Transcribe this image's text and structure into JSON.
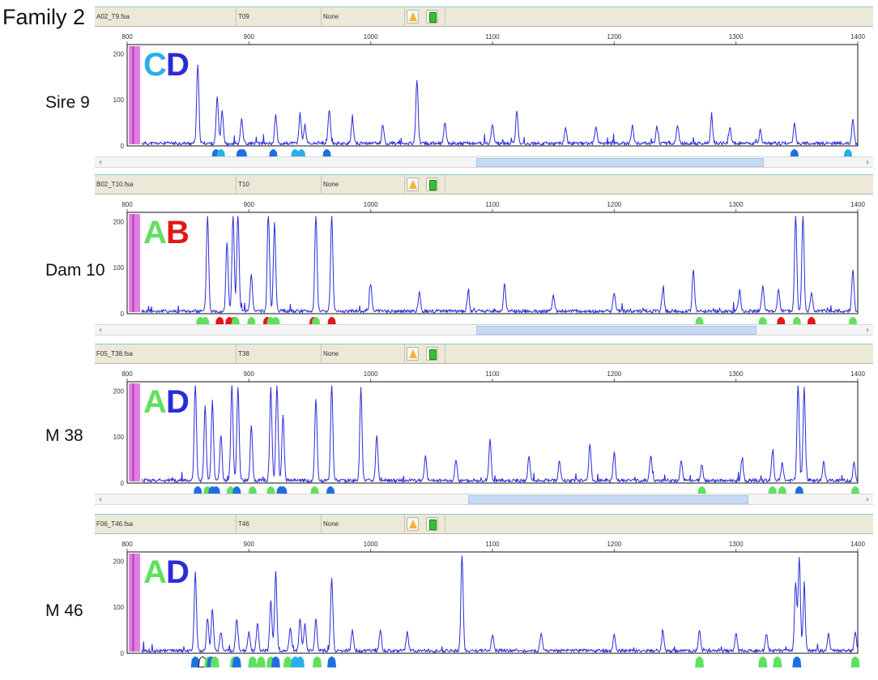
{
  "family_title": "Family 2",
  "colors": {
    "trace": "#2b2bd9",
    "pink": "#e07fe0",
    "peak_blue": "#1f6fe0",
    "peak_light_blue": "#2ab0e8",
    "peak_green": "#5fe05f",
    "peak_red": "#e01818",
    "axis": "#111111"
  },
  "panels": [
    {
      "sample_label": "Sire 9",
      "file": "A02_T9.fsa",
      "sample": "T09",
      "status": "None",
      "alleles": [
        {
          "letter": "C",
          "color": "#2ab0e8"
        },
        {
          "letter": "D",
          "color": "#2b2bd9"
        }
      ],
      "has_scrollbar": true,
      "scroll_thumb": [
        0.49,
        0.86
      ],
      "peaks": [
        [
          858,
          170
        ],
        [
          874,
          100
        ],
        [
          878,
          70
        ],
        [
          894,
          55
        ],
        [
          922,
          60
        ],
        [
          942,
          65
        ],
        [
          946,
          40
        ],
        [
          966,
          75
        ],
        [
          1038,
          140
        ],
        [
          1120,
          70
        ],
        [
          1280,
          55
        ],
        [
          1348,
          45
        ],
        [
          1396,
          50
        ]
      ],
      "noise": [
        [
          985,
          50
        ],
        [
          1010,
          40
        ],
        [
          1061,
          45
        ],
        [
          1100,
          40
        ],
        [
          1160,
          35
        ],
        [
          1185,
          35
        ],
        [
          1215,
          38
        ],
        [
          1235,
          35
        ],
        [
          1252,
          40
        ],
        [
          1295,
          35
        ],
        [
          1320,
          30
        ]
      ],
      "markers": [
        {
          "bp": 873,
          "c": "blue"
        },
        {
          "bp": 877,
          "c": "light_blue"
        },
        {
          "bp": 893,
          "c": "blue"
        },
        {
          "bp": 895,
          "c": "blue"
        },
        {
          "bp": 920,
          "c": "blue"
        },
        {
          "bp": 938,
          "c": "light_blue"
        },
        {
          "bp": 943,
          "c": "light_blue"
        },
        {
          "bp": 964,
          "c": "blue"
        },
        {
          "bp": 1348,
          "c": "blue"
        },
        {
          "bp": 1392,
          "c": "light_blue"
        }
      ]
    },
    {
      "sample_label": "Dam 10",
      "file": "B02_T10.fsa",
      "sample": "T10",
      "status": "None",
      "alleles": [
        {
          "letter": "A",
          "color": "#5fe05f"
        },
        {
          "letter": "B",
          "color": "#e01818"
        }
      ],
      "has_scrollbar": true,
      "scroll_thumb": [
        0.49,
        0.85
      ],
      "peaks": [
        [
          866,
          210
        ],
        [
          882,
          150
        ],
        [
          887,
          210
        ],
        [
          891,
          210
        ],
        [
          902,
          80
        ],
        [
          916,
          210
        ],
        [
          921,
          190
        ],
        [
          955,
          210
        ],
        [
          968,
          210
        ],
        [
          1110,
          60
        ],
        [
          1265,
          90
        ],
        [
          1322,
          55
        ],
        [
          1335,
          50
        ],
        [
          1349,
          210
        ],
        [
          1355,
          210
        ],
        [
          1396,
          90
        ]
      ],
      "noise": [
        [
          1000,
          60
        ],
        [
          1040,
          40
        ],
        [
          1080,
          40
        ],
        [
          1150,
          35
        ],
        [
          1200,
          40
        ],
        [
          1240,
          45
        ],
        [
          1303,
          45
        ],
        [
          1362,
          40
        ]
      ],
      "markers": [
        {
          "bp": 860,
          "c": "green"
        },
        {
          "bp": 864,
          "c": "green"
        },
        {
          "bp": 876,
          "c": "red"
        },
        {
          "bp": 884,
          "c": "red"
        },
        {
          "bp": 888,
          "c": "red"
        },
        {
          "bp": 889,
          "c": "green"
        },
        {
          "bp": 902,
          "c": "green"
        },
        {
          "bp": 915,
          "c": "red"
        },
        {
          "bp": 918,
          "c": "green"
        },
        {
          "bp": 922,
          "c": "green"
        },
        {
          "bp": 953,
          "c": "red"
        },
        {
          "bp": 955,
          "c": "green"
        },
        {
          "bp": 968,
          "c": "red"
        },
        {
          "bp": 1270,
          "c": "green"
        },
        {
          "bp": 1322,
          "c": "green"
        },
        {
          "bp": 1337,
          "c": "red"
        },
        {
          "bp": 1350,
          "c": "green"
        },
        {
          "bp": 1362,
          "c": "red"
        },
        {
          "bp": 1396,
          "c": "green"
        }
      ]
    },
    {
      "sample_label": "M 38",
      "file": "F05_T38.fsa",
      "sample": "T38",
      "status": "None",
      "alleles": [
        {
          "letter": "A",
          "color": "#5fe05f"
        },
        {
          "letter": "D",
          "color": "#2b2bd9"
        }
      ],
      "has_scrollbar": true,
      "scroll_thumb": [
        0.48,
        0.84
      ],
      "peaks": [
        [
          856,
          210
        ],
        [
          864,
          160
        ],
        [
          870,
          170
        ],
        [
          877,
          100
        ],
        [
          886,
          210
        ],
        [
          891,
          200
        ],
        [
          902,
          120
        ],
        [
          918,
          200
        ],
        [
          923,
          210
        ],
        [
          928,
          140
        ],
        [
          955,
          180
        ],
        [
          968,
          210
        ],
        [
          992,
          200
        ],
        [
          1005,
          100
        ],
        [
          1098,
          90
        ],
        [
          1180,
          80
        ],
        [
          1272,
          35
        ],
        [
          1330,
          65
        ],
        [
          1338,
          40
        ],
        [
          1351,
          210
        ],
        [
          1356,
          200
        ],
        [
          1397,
          40
        ]
      ],
      "noise": [
        [
          1045,
          55
        ],
        [
          1070,
          45
        ],
        [
          1130,
          50
        ],
        [
          1155,
          45
        ],
        [
          1200,
          60
        ],
        [
          1230,
          55
        ],
        [
          1255,
          45
        ],
        [
          1305,
          45
        ],
        [
          1372,
          40
        ]
      ],
      "markers": [
        {
          "bp": 858,
          "c": "blue"
        },
        {
          "bp": 866,
          "c": "green"
        },
        {
          "bp": 870,
          "c": "blue"
        },
        {
          "bp": 873,
          "c": "blue"
        },
        {
          "bp": 885,
          "c": "green"
        },
        {
          "bp": 890,
          "c": "blue"
        },
        {
          "bp": 903,
          "c": "green"
        },
        {
          "bp": 918,
          "c": "green"
        },
        {
          "bp": 926,
          "c": "blue"
        },
        {
          "bp": 928,
          "c": "blue"
        },
        {
          "bp": 954,
          "c": "green"
        },
        {
          "bp": 967,
          "c": "blue"
        },
        {
          "bp": 1272,
          "c": "green"
        },
        {
          "bp": 1330,
          "c": "green"
        },
        {
          "bp": 1338,
          "c": "green"
        },
        {
          "bp": 1352,
          "c": "blue"
        },
        {
          "bp": 1398,
          "c": "green"
        }
      ]
    },
    {
      "sample_label": "M 46",
      "file": "F06_T46.fsa",
      "sample": "T46",
      "status": "None",
      "alleles": [
        {
          "letter": "A",
          "color": "#5fe05f"
        },
        {
          "letter": "D",
          "color": "#2b2bd9"
        }
      ],
      "has_scrollbar": false,
      "scroll_thumb": [
        0,
        0
      ],
      "peaks": [
        [
          856,
          170
        ],
        [
          866,
          70
        ],
        [
          870,
          90
        ],
        [
          877,
          40
        ],
        [
          890,
          70
        ],
        [
          900,
          40
        ],
        [
          907,
          60
        ],
        [
          918,
          110
        ],
        [
          922,
          170
        ],
        [
          934,
          50
        ],
        [
          942,
          70
        ],
        [
          946,
          60
        ],
        [
          955,
          70
        ],
        [
          968,
          160
        ],
        [
          1008,
          45
        ],
        [
          1075,
          210
        ],
        [
          1270,
          45
        ],
        [
          1349,
          150
        ],
        [
          1352,
          200
        ],
        [
          1356,
          130
        ]
      ],
      "noise": [
        [
          985,
          45
        ],
        [
          1030,
          40
        ],
        [
          1100,
          35
        ],
        [
          1140,
          40
        ],
        [
          1200,
          35
        ],
        [
          1240,
          40
        ],
        [
          1300,
          40
        ],
        [
          1325,
          35
        ],
        [
          1376,
          35
        ],
        [
          1398,
          40
        ]
      ],
      "markers": [
        {
          "bp": 856,
          "c": "blue"
        },
        {
          "bp": 862,
          "c": "outline"
        },
        {
          "bp": 867,
          "c": "green"
        },
        {
          "bp": 869,
          "c": "blue"
        },
        {
          "bp": 872,
          "c": "green"
        },
        {
          "bp": 888,
          "c": "green"
        },
        {
          "bp": 890,
          "c": "blue"
        },
        {
          "bp": 903,
          "c": "green"
        },
        {
          "bp": 910,
          "c": "green"
        },
        {
          "bp": 918,
          "c": "green"
        },
        {
          "bp": 922,
          "c": "blue"
        },
        {
          "bp": 932,
          "c": "green"
        },
        {
          "bp": 938,
          "c": "light_blue"
        },
        {
          "bp": 942,
          "c": "light_blue"
        },
        {
          "bp": 956,
          "c": "green"
        },
        {
          "bp": 968,
          "c": "blue"
        },
        {
          "bp": 1270,
          "c": "green"
        },
        {
          "bp": 1322,
          "c": "green"
        },
        {
          "bp": 1334,
          "c": "green"
        },
        {
          "bp": 1350,
          "c": "blue"
        },
        {
          "bp": 1398,
          "c": "green"
        }
      ]
    }
  ],
  "chart_data": {
    "type": "line",
    "xlim": [
      800,
      1400
    ],
    "x_ticks": [
      800,
      900,
      1000,
      1100,
      1200,
      1300,
      1400
    ],
    "ylim": [
      0,
      220
    ],
    "y_ticks": [
      0,
      100,
      200
    ],
    "grid": false,
    "series": [
      {
        "name": "Sire 9",
        "note": "peaks listed in panels[0].peaks as [bp, height]"
      },
      {
        "name": "Dam 10"
      },
      {
        "name": "M 38"
      },
      {
        "name": "M 46"
      }
    ]
  }
}
